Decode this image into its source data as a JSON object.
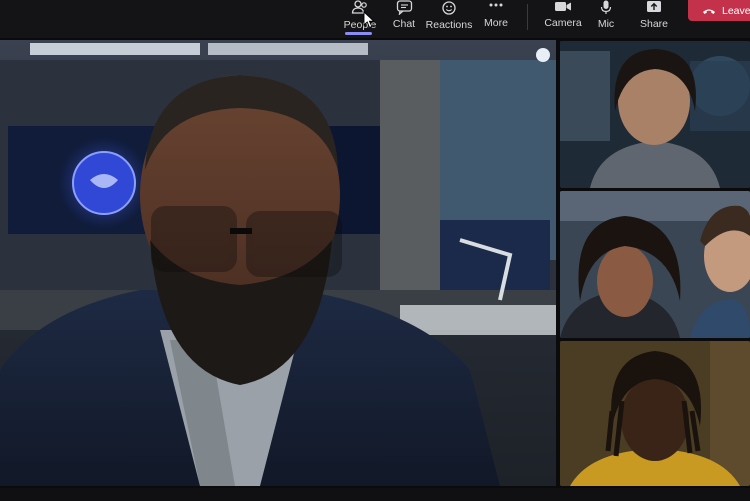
{
  "toolbar": {
    "people_label": "People",
    "chat_label": "Chat",
    "reactions_label": "Reactions",
    "more_label": "More",
    "camera_label": "Camera",
    "mic_label": "Mic",
    "share_label": "Share",
    "leave_label": "Leave"
  },
  "icons": {
    "people": "people-icon",
    "chat": "chat-icon",
    "reactions": "reactions-icon",
    "more": "more-icon",
    "camera": "camera-icon",
    "mic": "mic-icon",
    "share": "share-icon",
    "leave": "phone-hangup-icon",
    "seal": "agency-seal-icon"
  },
  "colors": {
    "toolbar_bg": "#141416",
    "accent": "#8b8cf2",
    "leave": "#c4314b",
    "text": "#d6d6da"
  },
  "participants": [
    {
      "id": "main-speaker"
    },
    {
      "id": "participant-1"
    },
    {
      "id": "participant-2"
    },
    {
      "id": "participant-3"
    }
  ]
}
